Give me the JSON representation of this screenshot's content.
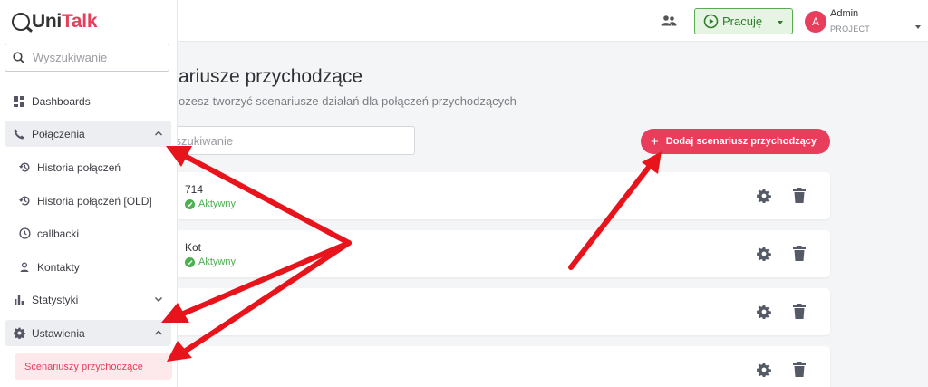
{
  "app": {
    "logo_prefix": "Uni",
    "logo_accent": "Talk",
    "brand_color": "#e83e5c"
  },
  "sidebar": {
    "search_placeholder": "Wyszukiwanie",
    "items": [
      {
        "label": "Dashboards",
        "icon": "dashboard-icon"
      },
      {
        "label": "Połączenia",
        "icon": "phone-icon",
        "expanded": true
      },
      {
        "label": "Historia połączeń",
        "icon": "history-icon"
      },
      {
        "label": "Historia połączeń [OLD]",
        "icon": "history-icon"
      },
      {
        "label": "callbacki",
        "icon": "clock-icon"
      },
      {
        "label": "Kontakty",
        "icon": "person-icon"
      },
      {
        "label": "Statystyki",
        "icon": "bar-chart-icon",
        "expanded": false
      },
      {
        "label": "Ustawienia",
        "icon": "gear-icon",
        "expanded": true
      },
      {
        "label": "Scenariuszy przychodzące",
        "active": true
      }
    ]
  },
  "topbar": {
    "status_label": "Pracuję",
    "status_color": "#4caf50",
    "user_initial": "A",
    "user_name": "Admin",
    "user_role": "PROJECT"
  },
  "main": {
    "title": "ariusze przychodzące",
    "description": "ożesz tworzyć scenariusze działań dla połączeń przychodzących",
    "search_placeholder": "yszukiwanie",
    "add_button": "Dodaj scenariusz przychodzący",
    "scenarios": [
      {
        "name": "714",
        "status": "Aktywny"
      },
      {
        "name": "Kot",
        "status": "Aktywny"
      },
      {
        "name": "",
        "status": ""
      },
      {
        "name": "",
        "status": ""
      }
    ]
  },
  "annotation_color": "#e8141c"
}
